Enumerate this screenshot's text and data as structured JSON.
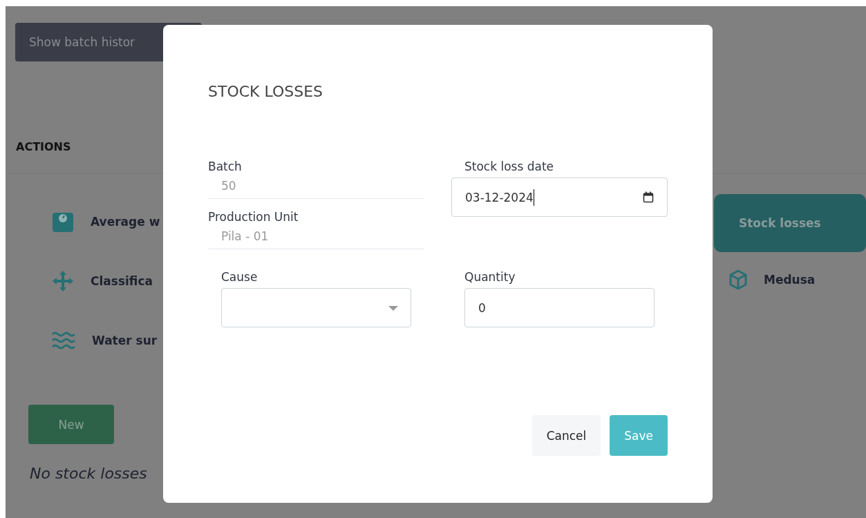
{
  "toolbar": {
    "buttons": [
      {
        "label": "Show batch histor"
      }
    ]
  },
  "actions": {
    "title": "ACTIONS",
    "left_items": [
      {
        "label": "Average w",
        "selected": false
      },
      {
        "label": "Classifica",
        "selected": false
      },
      {
        "label": "Water sur",
        "selected": false
      }
    ],
    "right_items": [
      {
        "label": "Stock losses",
        "selected": true
      },
      {
        "label": "Medusa",
        "selected": false
      }
    ]
  },
  "new_button": "New",
  "empty_message": "No stock losses",
  "dialog": {
    "title": "STOCK LOSSES",
    "batch": {
      "label": "Batch",
      "value": "50",
      "disabled": true
    },
    "production_unit": {
      "label": "Production Unit",
      "value": "Pila - 01",
      "disabled": true
    },
    "stock_loss_date": {
      "label": "Stock loss date",
      "value": "03-12-2024"
    },
    "cause": {
      "label": "Cause"
    },
    "quantity": {
      "label": "Quantity",
      "value": "0"
    },
    "buttons": [
      {
        "label": "Cancel",
        "kind": "secondary"
      },
      {
        "label": "Save",
        "kind": "primary"
      }
    ]
  }
}
